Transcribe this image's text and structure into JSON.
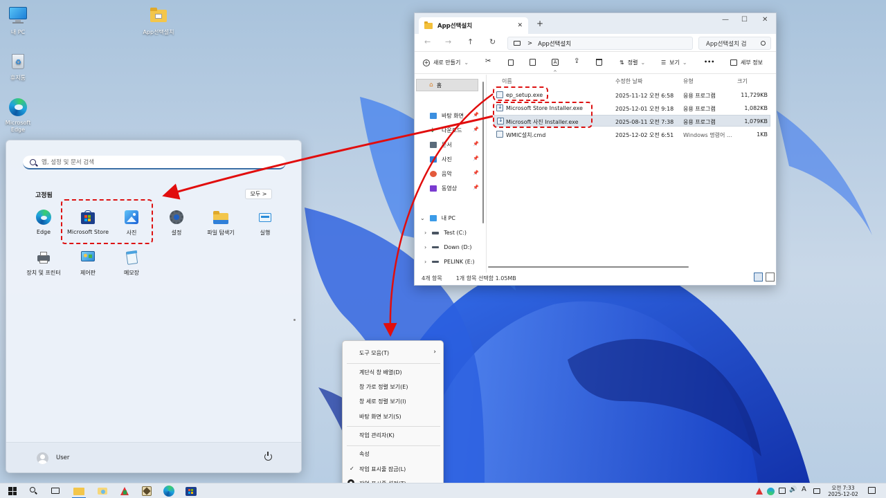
{
  "desktop": {
    "icons": [
      {
        "label": "내 PC"
      },
      {
        "label": "휴지통"
      },
      {
        "label": "Microsoft Edge"
      },
      {
        "label": "App선택설치"
      }
    ]
  },
  "start_menu": {
    "search_placeholder": "앱, 설정 및 문서 검색",
    "pinned_title": "고정됨",
    "all_button": "모두 >",
    "apps": [
      {
        "label": "Edge",
        "icon": "edge-icon"
      },
      {
        "label": "Microsoft Store",
        "icon": "store-icon"
      },
      {
        "label": "사진",
        "icon": "photos-icon"
      },
      {
        "label": "설정",
        "icon": "gear-icon"
      },
      {
        "label": "파일 탐색기",
        "icon": "folder-icon"
      },
      {
        "label": "실행",
        "icon": "run-icon"
      },
      {
        "label": "장치 및 프린터",
        "icon": "printer-icon"
      },
      {
        "label": "제어판",
        "icon": "control-panel-icon"
      },
      {
        "label": "메모장",
        "icon": "notepad-icon"
      }
    ],
    "user": "User"
  },
  "explorer": {
    "tab_title": "App선택설치",
    "tab_close": "✕",
    "new_tab": "+",
    "window_controls": {
      "minimize": "—",
      "maximize": "☐",
      "close": "✕"
    },
    "nav_buttons": {
      "back": "←",
      "forward": "→",
      "up": "↑",
      "refresh": "↻"
    },
    "address": "App선택설치",
    "address_sep": ">",
    "search": "App선택설치 검",
    "toolbar": {
      "new": "새로 만들기",
      "sort": "정렬",
      "view": "보기",
      "more": "•••",
      "details": "세부 정보"
    },
    "nav": {
      "home": "홈",
      "pinned": [
        {
          "label": "바탕 화면"
        },
        {
          "label": "다운로드"
        },
        {
          "label": "문서"
        },
        {
          "label": "사진"
        },
        {
          "label": "음악"
        },
        {
          "label": "동영상"
        }
      ],
      "this_pc": "내 PC",
      "drives": [
        {
          "label": "Test (C:)"
        },
        {
          "label": "Down (D:)"
        },
        {
          "label": "PELINK (E:)"
        }
      ]
    },
    "columns": {
      "name": "이름",
      "modified": "수정한 날짜",
      "type": "유형",
      "size": "크기"
    },
    "files": [
      {
        "name": "ep_setup.exe",
        "modified": "2025-11-12 오전 6:58",
        "type": "응용 프로그램",
        "size": "11,729KB"
      },
      {
        "name": "Microsoft Store Installer.exe",
        "modified": "2025-12-01 오전 9:18",
        "type": "응용 프로그램",
        "size": "1,082KB"
      },
      {
        "name": "Microsoft 사진 Installer.exe",
        "modified": "2025-08-11 오전 7:38",
        "type": "응용 프로그램",
        "size": "1,079KB"
      },
      {
        "name": "WMIC설치.cmd",
        "modified": "2025-12-02 오전 6:51",
        "type": "Windows 명령어 ...",
        "size": "1KB"
      }
    ],
    "status_count": "4개 항목",
    "status_selected": "1개 항목 선택함 1.05MB"
  },
  "context_menu": {
    "items": [
      {
        "label": "도구 모음(T)"
      },
      {
        "label": "계단식 창 배열(D)"
      },
      {
        "label": "창 가로 정렬 보기(E)"
      },
      {
        "label": "창 세로 정렬 보기(I)"
      },
      {
        "label": "바탕 화면 보기(S)"
      },
      {
        "label": "작업 관리자(K)"
      },
      {
        "label": "속성"
      },
      {
        "label": "작업 표시줄 잠금(L)"
      },
      {
        "label": "작업 표시줄 설정(T)"
      }
    ],
    "check": "✓",
    "submenu_arrow": "›"
  },
  "taskbar": {
    "time": "오전 7:33",
    "date": "2025-12-02",
    "ime": "A"
  }
}
